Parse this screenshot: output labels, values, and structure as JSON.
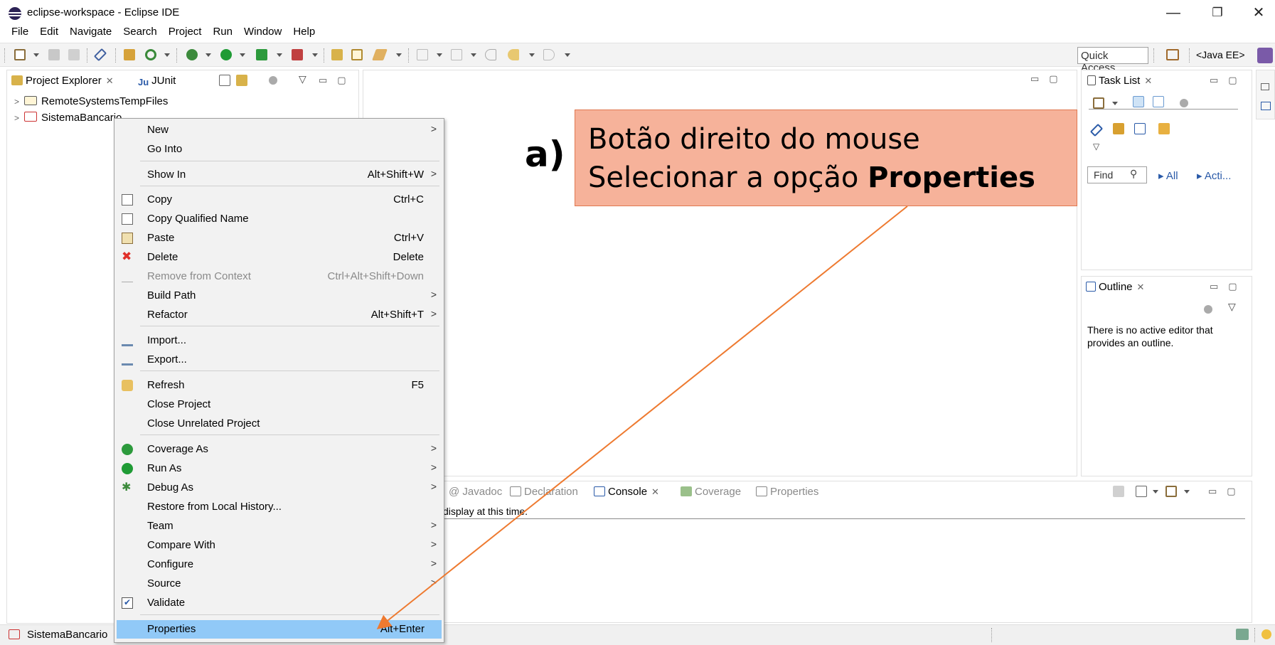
{
  "window": {
    "title": "eclipse-workspace - Eclipse IDE",
    "minimize": "—",
    "restore": "❐",
    "close": "✕"
  },
  "menubar": [
    "File",
    "Edit",
    "Navigate",
    "Search",
    "Project",
    "Run",
    "Window",
    "Help"
  ],
  "toolbar": {
    "quick_access": "Quick Access",
    "perspective": "<Java EE>"
  },
  "project_explorer": {
    "tab_label": "Project Explorer",
    "junit_tab": "JUnit",
    "tree": [
      {
        "label": "RemoteSystemsTempFiles"
      },
      {
        "label": "SistemaBancario"
      }
    ]
  },
  "context_menu": {
    "items": [
      {
        "label": "New",
        "shortcut": "",
        "submenu": true
      },
      {
        "label": "Go Into",
        "shortcut": ""
      },
      {
        "label": "Show In",
        "shortcut": "Alt+Shift+W",
        "submenu": true
      },
      {
        "label": "Copy",
        "shortcut": "Ctrl+C"
      },
      {
        "label": "Copy Qualified Name",
        "shortcut": ""
      },
      {
        "label": "Paste",
        "shortcut": "Ctrl+V"
      },
      {
        "label": "Delete",
        "shortcut": "Delete"
      },
      {
        "label": "Remove from Context",
        "shortcut": "Ctrl+Alt+Shift+Down",
        "disabled": true
      },
      {
        "label": "Build Path",
        "shortcut": "",
        "submenu": true
      },
      {
        "label": "Refactor",
        "shortcut": "Alt+Shift+T",
        "submenu": true
      },
      {
        "label": "Import...",
        "shortcut": ""
      },
      {
        "label": "Export...",
        "shortcut": ""
      },
      {
        "label": "Refresh",
        "shortcut": "F5"
      },
      {
        "label": "Close Project",
        "shortcut": ""
      },
      {
        "label": "Close Unrelated Project",
        "shortcut": ""
      },
      {
        "label": "Coverage As",
        "shortcut": "",
        "submenu": true
      },
      {
        "label": "Run As",
        "shortcut": "",
        "submenu": true
      },
      {
        "label": "Debug As",
        "shortcut": "",
        "submenu": true
      },
      {
        "label": "Restore from Local History...",
        "shortcut": ""
      },
      {
        "label": "Team",
        "shortcut": "",
        "submenu": true
      },
      {
        "label": "Compare With",
        "shortcut": "",
        "submenu": true
      },
      {
        "label": "Configure",
        "shortcut": "",
        "submenu": true
      },
      {
        "label": "Source",
        "shortcut": "",
        "submenu": true
      },
      {
        "label": "Validate",
        "shortcut": ""
      },
      {
        "label": "Properties",
        "shortcut": "Alt+Enter",
        "selected": true
      }
    ],
    "submenu_glyph": ">"
  },
  "task_list": {
    "tab_label": "Task List",
    "find_placeholder": "Find",
    "all_link": "All",
    "acti_link": "Acti..."
  },
  "outline": {
    "tab_label": "Outline",
    "message": "There is no active editor that provides an outline."
  },
  "bottom_panel": {
    "tabs": [
      "Javadoc",
      "Declaration",
      "Console",
      "Coverage",
      "Properties"
    ],
    "console_text": "display at this time."
  },
  "statusbar": {
    "selection": "SistemaBancario"
  },
  "annotation": {
    "letter": "a)",
    "line1": "Botão direito do mouse",
    "line2_prefix": "Selecionar a opção ",
    "line2_bold": "Properties",
    "box_color": "#f6b29a",
    "arrow_color": "#ee7a30"
  }
}
